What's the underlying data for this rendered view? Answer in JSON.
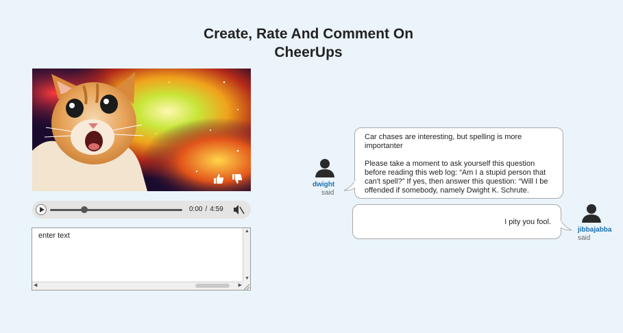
{
  "page": {
    "title_line1": "Create, Rate And Comment On",
    "title_line2": "CheerUps"
  },
  "video": {
    "like_icon": "thumbs-up-icon",
    "dislike_icon": "thumbs-down-icon",
    "controls": {
      "play_icon": "play-icon",
      "progress": 0.26,
      "current_time": "0:00",
      "separator": "/",
      "duration": "4:59",
      "mute_icon": "speaker-muted-icon"
    }
  },
  "comment_input": {
    "value": "enter text"
  },
  "comments": [
    {
      "user": "dwight",
      "said": "said",
      "paragraphs": [
        "Car chases are interesting, but spelling is more importanter",
        "Please take a moment to ask yourself this question before reading this web log: “Am I a stupid person that can't spell?” If yes, then answer this question: “Will I be offended if somebody, namely Dwight K. Schrute."
      ]
    },
    {
      "user": "jibbajabba",
      "said": "said",
      "paragraphs": [
        "I pity you fool."
      ]
    }
  ],
  "colors": {
    "background": "#eaf4fa",
    "username": "#1b6fb0",
    "bubble_border": "#a8a8a8"
  }
}
